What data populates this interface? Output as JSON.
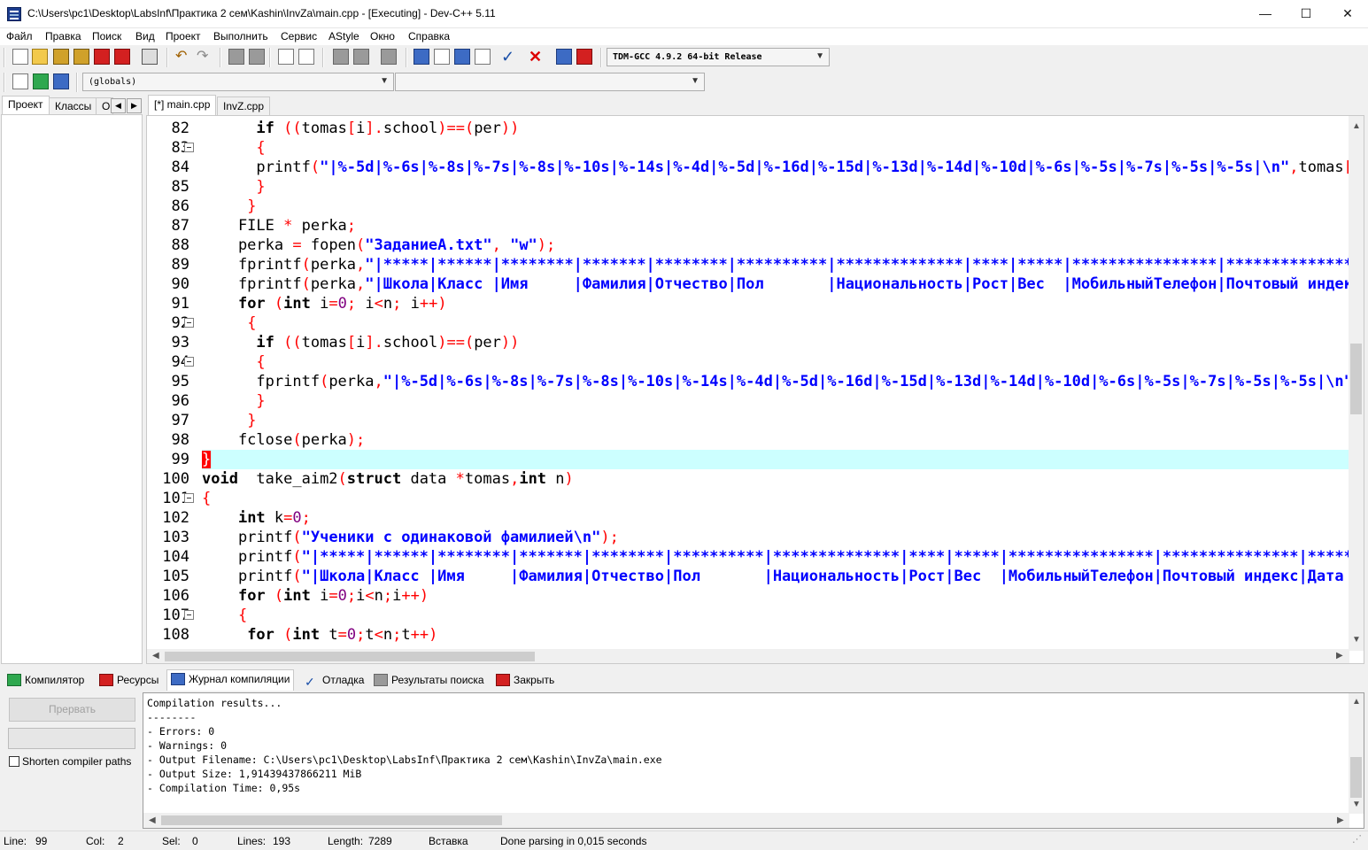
{
  "window": {
    "title": "C:\\Users\\pc1\\Desktop\\LabsInf\\Практика 2 сем\\Kashin\\InvZa\\main.cpp - [Executing] - Dev-C++ 5.11",
    "minimize": "—",
    "maximize": "☐",
    "close": "✕"
  },
  "menu": [
    "Файл",
    "Правка",
    "Поиск",
    "Вид",
    "Проект",
    "Выполнить",
    "Сервис",
    "AStyle",
    "Окно",
    "Справка"
  ],
  "toolbar": {
    "compiler": "TDM-GCC 4.9.2 64-bit Release",
    "globals": "(globals)",
    "members": ""
  },
  "left_tabs": [
    "Проект",
    "Классы",
    "О"
  ],
  "editor_tabs": [
    "[*] main.cpp",
    "InvZ.cpp"
  ],
  "code": {
    "line_numbers": [
      "82",
      "83",
      "84",
      "85",
      "86",
      "87",
      "88",
      "89",
      "90",
      "91",
      "92",
      "93",
      "94",
      "95",
      "96",
      "97",
      "98",
      "99",
      "100",
      "101",
      "102",
      "103",
      "104",
      "105",
      "106",
      "107",
      "108"
    ],
    "current_line": "99"
  },
  "bottom_tabs": [
    "Компилятор",
    "Ресурсы",
    "Журнал компиляции",
    "Отладка",
    "Результаты поиска",
    "Закрыть"
  ],
  "bottom_panel": {
    "abort_label": "Прервать",
    "shorten_label": "Shorten compiler paths",
    "log": [
      "Compilation results...",
      "--------",
      "- Errors: 0",
      "- Warnings: 0",
      "- Output Filename: C:\\Users\\pc1\\Desktop\\LabsInf\\Практика 2 сем\\Kashin\\InvZa\\main.exe",
      "- Output Size: 1,91439437866211 MiB",
      "- Compilation Time: 0,95s"
    ]
  },
  "status": {
    "line_label": "Line:",
    "line": "99",
    "col_label": "Col:",
    "col": "2",
    "sel_label": "Sel:",
    "sel": "0",
    "lines_label": "Lines:",
    "lines": "193",
    "length_label": "Length:",
    "length": "7289",
    "mode": "Вставка",
    "message": "Done parsing in 0,015 seconds"
  }
}
